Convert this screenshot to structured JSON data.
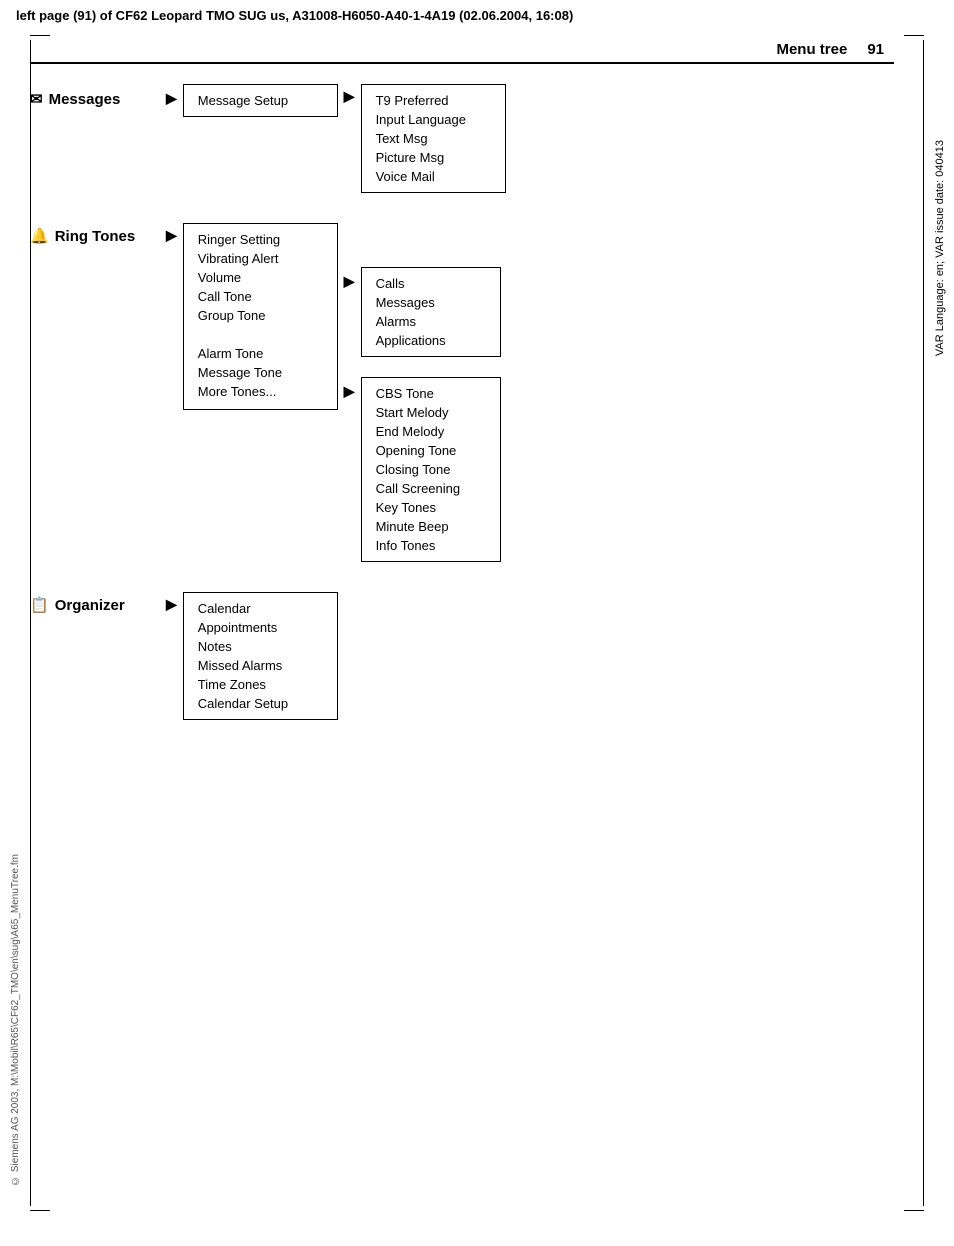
{
  "header": {
    "text": "left page (91) of CF62 Leopard TMO SUG us, A31008-H6050-A40-1-4A19 (02.06.2004, 16:08)"
  },
  "side_text_top": "VAR Language: en; VAR issue date: 040413",
  "side_text_bottom": "© Siemens AG 2003, M:\\Mobil\\R65\\CF62_TMO\\en\\sug\\A65_MenuTree.fm",
  "page_title": "Menu tree",
  "page_number": "91",
  "sections": [
    {
      "id": "messages",
      "label": "Messages",
      "icon": "✉",
      "level2": [
        {
          "label": "Message Setup",
          "has_arrow": true,
          "level3": [
            "T9 Preferred",
            "Input Language",
            "Text Msg",
            "Picture Msg",
            "Voice Mail"
          ]
        }
      ]
    },
    {
      "id": "ring_tones",
      "label": "Ring Tones",
      "icon": "🔔",
      "level2_items": [
        "Ringer Setting",
        "Vibrating Alert",
        "Volume",
        "Call Tone",
        "Group Tone",
        "",
        "Alarm Tone",
        "Message Tone",
        "More Tones..."
      ],
      "volume_children": [
        "Calls",
        "Messages",
        "Alarms",
        "Applications"
      ],
      "more_tones_children": [
        "CBS Tone",
        "Start Melody",
        "End Melody",
        "Opening Tone",
        "Closing Tone",
        "Call Screening",
        "Key Tones",
        "Minute Beep",
        "Info Tones"
      ]
    },
    {
      "id": "organizer",
      "label": "Organizer",
      "icon": "📋",
      "level2": [
        "Calendar",
        "Appointments",
        "Notes",
        "Missed Alarms",
        "Time Zones",
        "Calendar Setup"
      ]
    }
  ]
}
